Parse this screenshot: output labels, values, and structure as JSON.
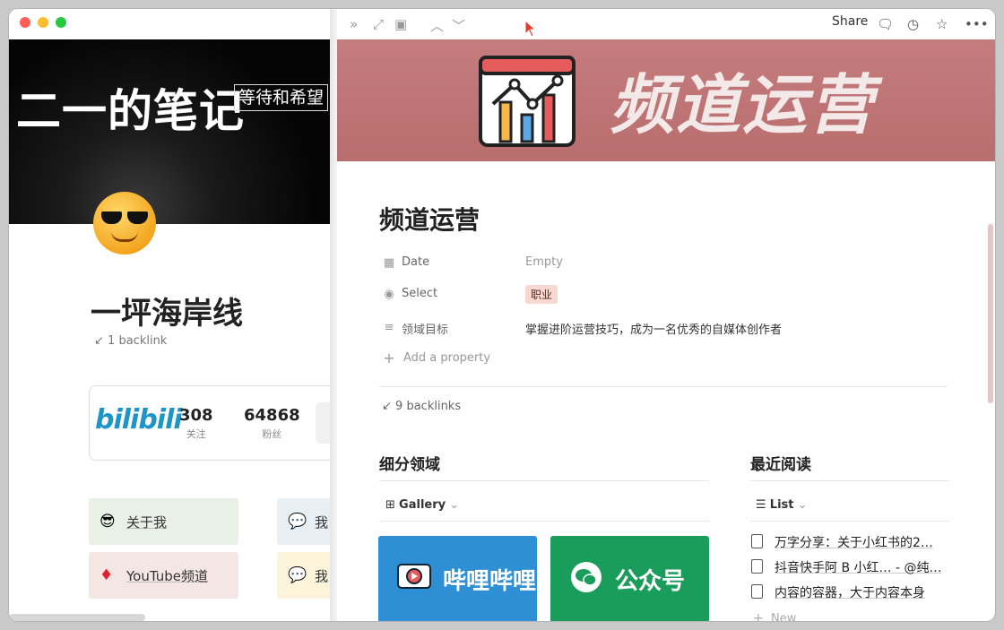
{
  "left_window": {
    "cover_text": "二一的笔记",
    "cover_tag": "等待和希望",
    "page_title": "一坪海岸线",
    "backlinks": "1 backlink",
    "bili_logo": "bilibili",
    "stats": [
      {
        "number": "308",
        "label": "关注"
      },
      {
        "number": "64868",
        "label": "粉丝"
      }
    ],
    "tiles": [
      {
        "emoji": "😎",
        "label": "关于我",
        "bg": "#e9f0e6"
      },
      {
        "emoji": "💬",
        "label": "我",
        "bg": "#e8f0f6"
      },
      {
        "emoji": "♦️",
        "label": "YouTube频道",
        "bg": "#f5e6e6"
      },
      {
        "emoji": "💬",
        "label": "我",
        "bg": "#fbf3da"
      }
    ]
  },
  "peek": {
    "topbar": {
      "share": "Share"
    },
    "cover_title": "频道运营",
    "page_title": "频道运营",
    "properties": [
      {
        "icon": "calendar-icon",
        "key": "Date",
        "value": "Empty"
      },
      {
        "icon": "select-icon",
        "key": "Select",
        "value": "职业"
      },
      {
        "icon": "text-icon",
        "key": "领域目标",
        "value": "掌握进阶运营技巧，成为一名优秀的自媒体创作者"
      }
    ],
    "add_property": "Add a property",
    "backlinks": "9 backlinks",
    "sections": {
      "subdomain": {
        "title": "细分领域",
        "view": "Gallery",
        "cards": [
          {
            "label": "哔哩哔哩",
            "color": "#2e8fd4"
          },
          {
            "label": "公众号",
            "color": "#1a9c5a"
          }
        ]
      },
      "recent": {
        "title": "最近阅读",
        "view": "List",
        "items": [
          "万字分享：关于小红书的2…",
          "抖音快手阿 B 小红… - @纯…",
          "内容的容器，大于内容本身"
        ],
        "new": "New"
      }
    }
  }
}
